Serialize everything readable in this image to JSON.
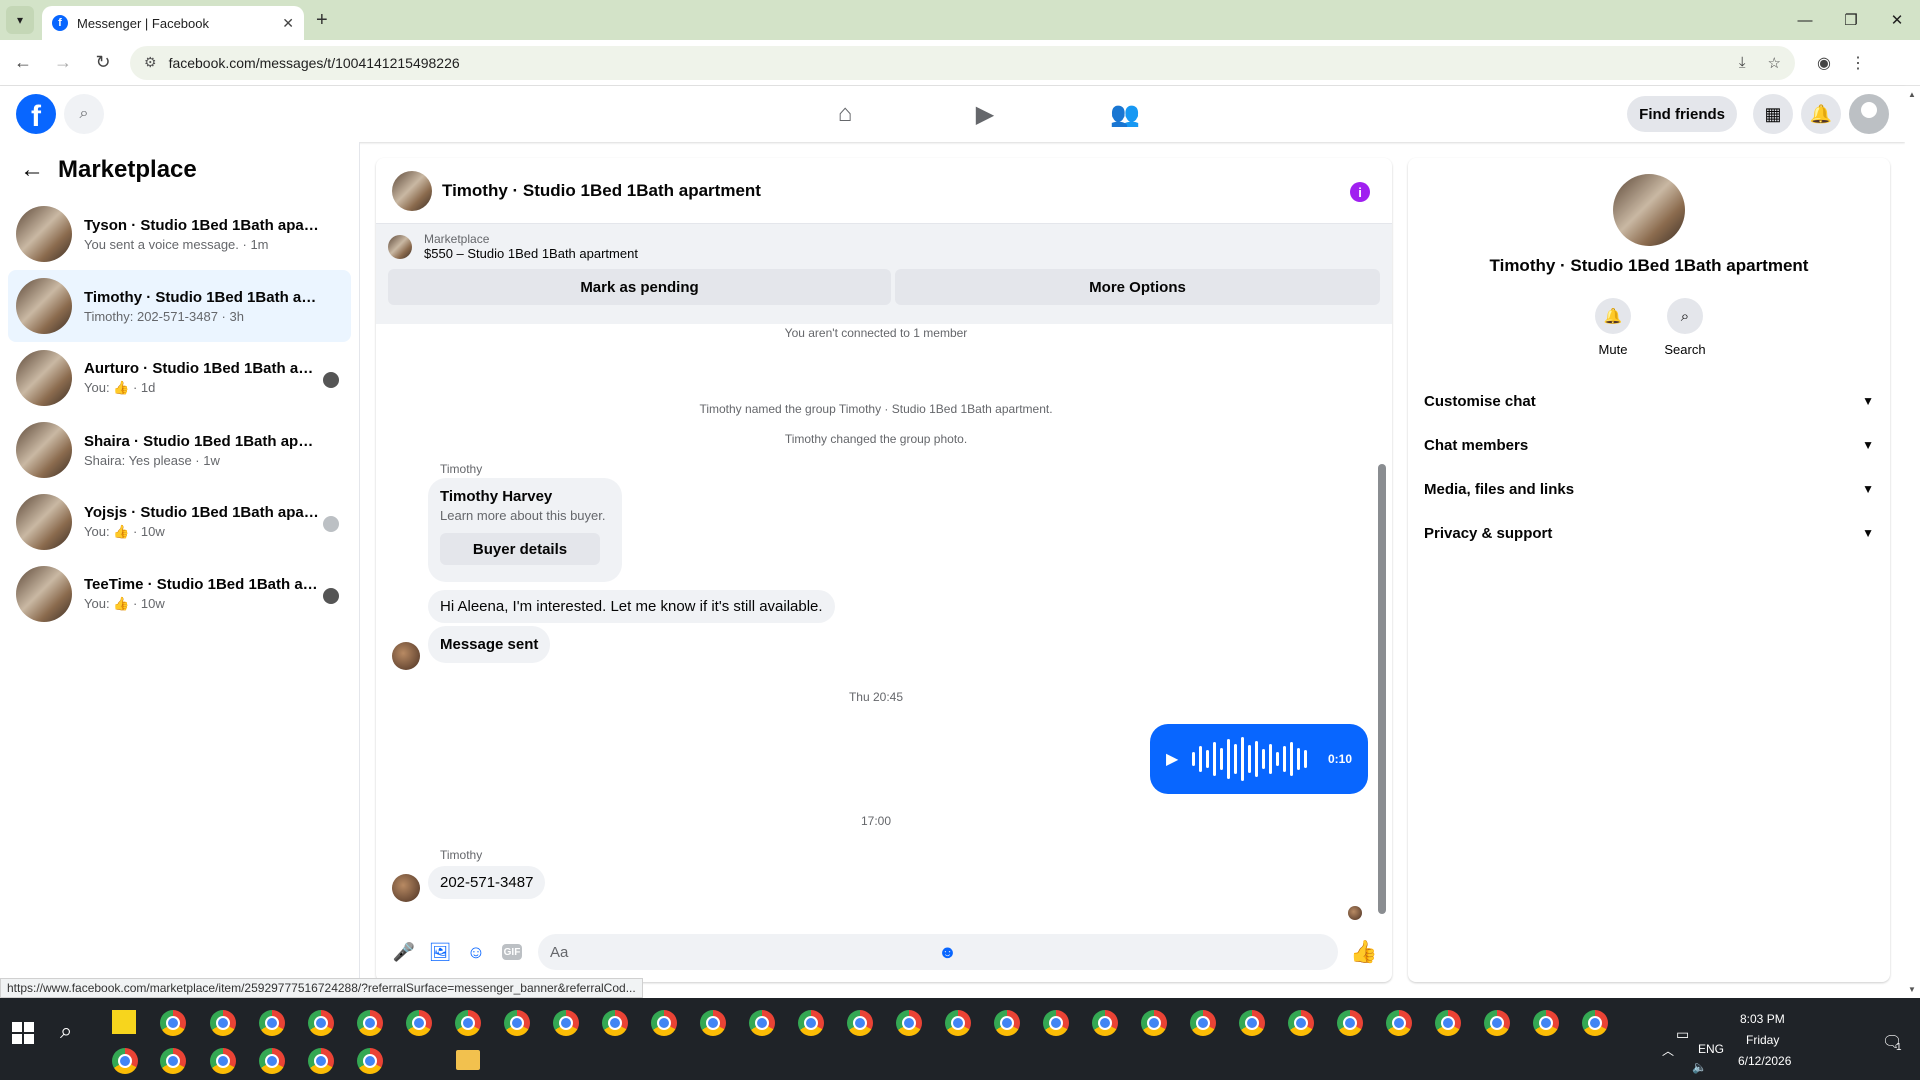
{
  "browser": {
    "tab_title": "Messenger | Facebook",
    "url": "facebook.com/messages/t/1004141215498226",
    "status_url": "https://www.facebook.com/marketplace/item/25929777516724288/?referralSurface=messenger_banner&referralCod..."
  },
  "header": {
    "find_friends": "Find friends"
  },
  "left": {
    "title": "Marketplace",
    "conversations": [
      {
        "name": "Tyson · Studio 1Bed 1Bath apartment",
        "sub": "You sent a voice message. · 1m"
      },
      {
        "name": "Timothy · Studio 1Bed 1Bath apart...",
        "sub": "Timothy: 202-571-3487 · 3h"
      },
      {
        "name": "Aurturo · Studio 1Bed 1Bath apa...",
        "sub": "You: 👍 · 1d"
      },
      {
        "name": "Shaira · Studio 1Bed 1Bath apartm...",
        "sub": "Shaira: Yes please · 1w"
      },
      {
        "name": "Yojsjs · Studio 1Bed 1Bath apart...",
        "sub": "You: 👍 · 10w"
      },
      {
        "name": "TeeTime · Studio 1Bed 1Bath apa...",
        "sub": "You: 👍 · 10w"
      }
    ]
  },
  "chat": {
    "title": "Timothy · Studio 1Bed 1Bath apartment",
    "banner_label": "Marketplace",
    "banner_item": "$550 – Studio 1Bed 1Bath apartment",
    "mark_pending": "Mark as pending",
    "more_options": "More Options",
    "sys_not_connected": "You aren't connected to 1 member",
    "sys_named": "Timothy named the group Timothy · Studio 1Bed 1Bath apartment.",
    "sys_photo": "Timothy changed the group photo.",
    "sender": "Timothy",
    "buyer_name": "Timothy Harvey",
    "buyer_desc": "Learn more about this buyer.",
    "buyer_button": "Buyer details",
    "msg_interest": "Hi Aleena, I'm interested. Let me know if it's still available.",
    "msg_sent": "Message sent",
    "time_1": "Thu 20:45",
    "voice_duration": "0:10",
    "time_2": "17:00",
    "sender_2": "Timothy",
    "msg_phone": "202-571-3487",
    "composer_placeholder": "Aa"
  },
  "right": {
    "name": "Timothy · Studio 1Bed 1Bath apartment",
    "mute": "Mute",
    "search": "Search",
    "items": [
      "Customise chat",
      "Chat members",
      "Media, files and links",
      "Privacy & support"
    ]
  },
  "taskbar": {
    "time": "8:03 PM",
    "day": "Friday",
    "date": "6/12/2026",
    "lang": "ENG",
    "notif_count": "1"
  }
}
